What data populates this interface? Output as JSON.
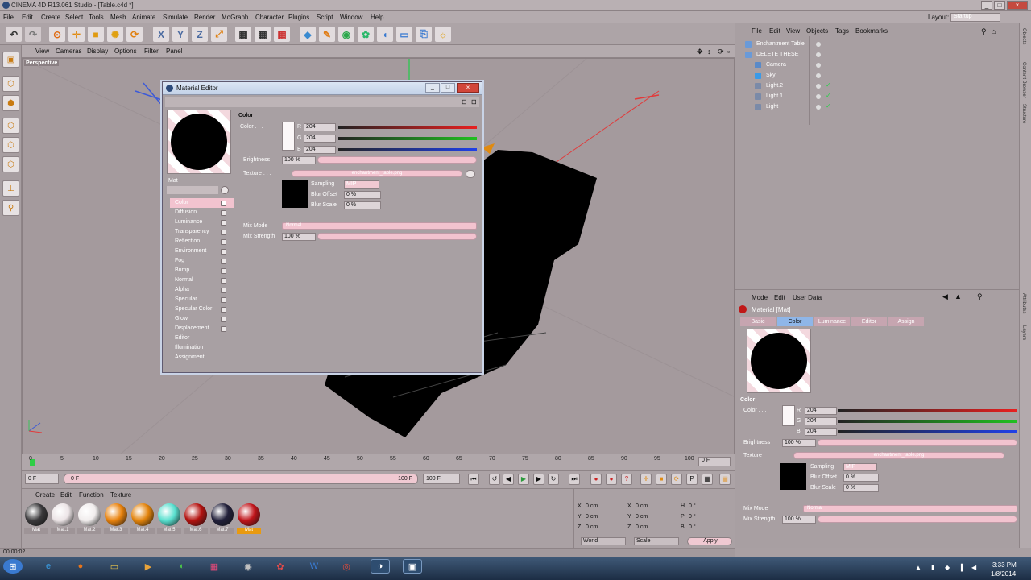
{
  "app": {
    "title": "CINEMA 4D R13.061 Studio - [Table.c4d *]",
    "menu": [
      "File",
      "Edit",
      "Create",
      "Select",
      "Tools",
      "Mesh",
      "Animate",
      "Simulate",
      "Render",
      "MoGraph",
      "Character",
      "Plugins",
      "Script",
      "Window",
      "Help"
    ],
    "layout_label": "Layout:",
    "layout_value": "Startup"
  },
  "viewport": {
    "menu": [
      "View",
      "Cameras",
      "Display",
      "Options",
      "Filter",
      "Panel"
    ],
    "label": "Perspective"
  },
  "timeline": {
    "ticks": [
      "0",
      "5",
      "10",
      "15",
      "20",
      "25",
      "30",
      "35",
      "40",
      "45",
      "50",
      "55",
      "60",
      "65",
      "70",
      "75",
      "80",
      "85",
      "90",
      "95",
      "100"
    ],
    "frame_box": "0 F",
    "start_field": "0 F",
    "start_field2": "0 F",
    "end_field": "100 F",
    "end_field2": "100 F"
  },
  "material_manager": {
    "menu": [
      "Create",
      "Edit",
      "Function",
      "Texture"
    ],
    "materials": [
      {
        "label": "Mat",
        "color": "#3b3a3c"
      },
      {
        "label": "Mat.1",
        "color": "#ece4e6"
      },
      {
        "label": "Mat.2",
        "color": "#f1eded"
      },
      {
        "label": "Mat.3",
        "color": "#e9820c"
      },
      {
        "label": "Mat.4",
        "color": "#e3840c"
      },
      {
        "label": "Mat.5",
        "color": "#59e0cf"
      },
      {
        "label": "Mat.6",
        "color": "#b3120f"
      },
      {
        "label": "Mat.7",
        "color": "#22203a"
      },
      {
        "label": "Mat",
        "color": "#c0141a"
      }
    ]
  },
  "coords": {
    "rows": [
      {
        "a": "X",
        "av": "0 cm",
        "b": "X",
        "bv": "0 cm",
        "c": "H",
        "cv": "0 °"
      },
      {
        "a": "Y",
        "av": "0 cm",
        "b": "Y",
        "bv": "0 cm",
        "c": "P",
        "cv": "0 °"
      },
      {
        "a": "Z",
        "av": "0 cm",
        "b": "Z",
        "bv": "0 cm",
        "c": "B",
        "cv": "0 °"
      }
    ],
    "world": "World",
    "scale": "Scale",
    "apply": "Apply"
  },
  "status": "00:00:02",
  "objects": {
    "menu": [
      "File",
      "Edit",
      "View",
      "Objects",
      "Tags",
      "Bookmarks"
    ],
    "items": [
      "Enchantment Table",
      "DELETE THESE",
      "Camera",
      "Sky",
      "Light.2",
      "Light.1",
      "Light"
    ]
  },
  "side_tabs": [
    "Objects",
    "Content Browser",
    "Structure",
    "Attributes",
    "Layers"
  ],
  "attributes": {
    "menu": [
      "Mode",
      "Edit",
      "User Data"
    ],
    "header": "Material [Mat]",
    "tabs": [
      "Basic",
      "Color",
      "Luminance",
      "Editor",
      "Assign"
    ],
    "section": "Color",
    "color_label": "Color . . .",
    "r": "204",
    "g": "204",
    "b": "204",
    "brightness_label": "Brightness",
    "brightness": "100 %",
    "texture_label": "Texture",
    "texture_file": "enchantment_table.png",
    "sampling_label": "Sampling",
    "sampling": "MIP",
    "blur_offset_label": "Blur Offset",
    "blur_offset": "0 %",
    "blur_scale_label": "Blur Scale",
    "blur_scale": "0 %",
    "mix_mode_label": "Mix Mode",
    "mix_mode": "Normal",
    "mix_strength_label": "Mix Strength",
    "mix_strength": "100 %"
  },
  "material_editor": {
    "title": "Material Editor",
    "name": "Mat",
    "channels": [
      "Color",
      "Diffusion",
      "Luminance",
      "Transparency",
      "Reflection",
      "Environment",
      "Fog",
      "Bump",
      "Normal",
      "Alpha",
      "Specular",
      "Specular Color",
      "Glow",
      "Displacement",
      "Editor",
      "Illumination",
      "Assignment"
    ],
    "section": "Color",
    "color_label": "Color . . .",
    "r": "204",
    "g": "204",
    "b": "204",
    "brightness_label": "Brightness",
    "brightness": "100 %",
    "texture_label": "Texture . . .",
    "texture_file": "enchantment_table.png",
    "sampling_label": "Sampling",
    "sampling": "MIP",
    "blur_offset_label": "Blur Offset",
    "blur_offset": "0 %",
    "blur_scale_label": "Blur Scale",
    "blur_scale": "0 %",
    "mix_mode_label": "Mix Mode",
    "mix_mode": "Normal",
    "mix_strength_label": "Mix Strength",
    "mix_strength": "100 %"
  },
  "taskbar": {
    "time": "3:33 PM",
    "date": "1/8/2014"
  }
}
